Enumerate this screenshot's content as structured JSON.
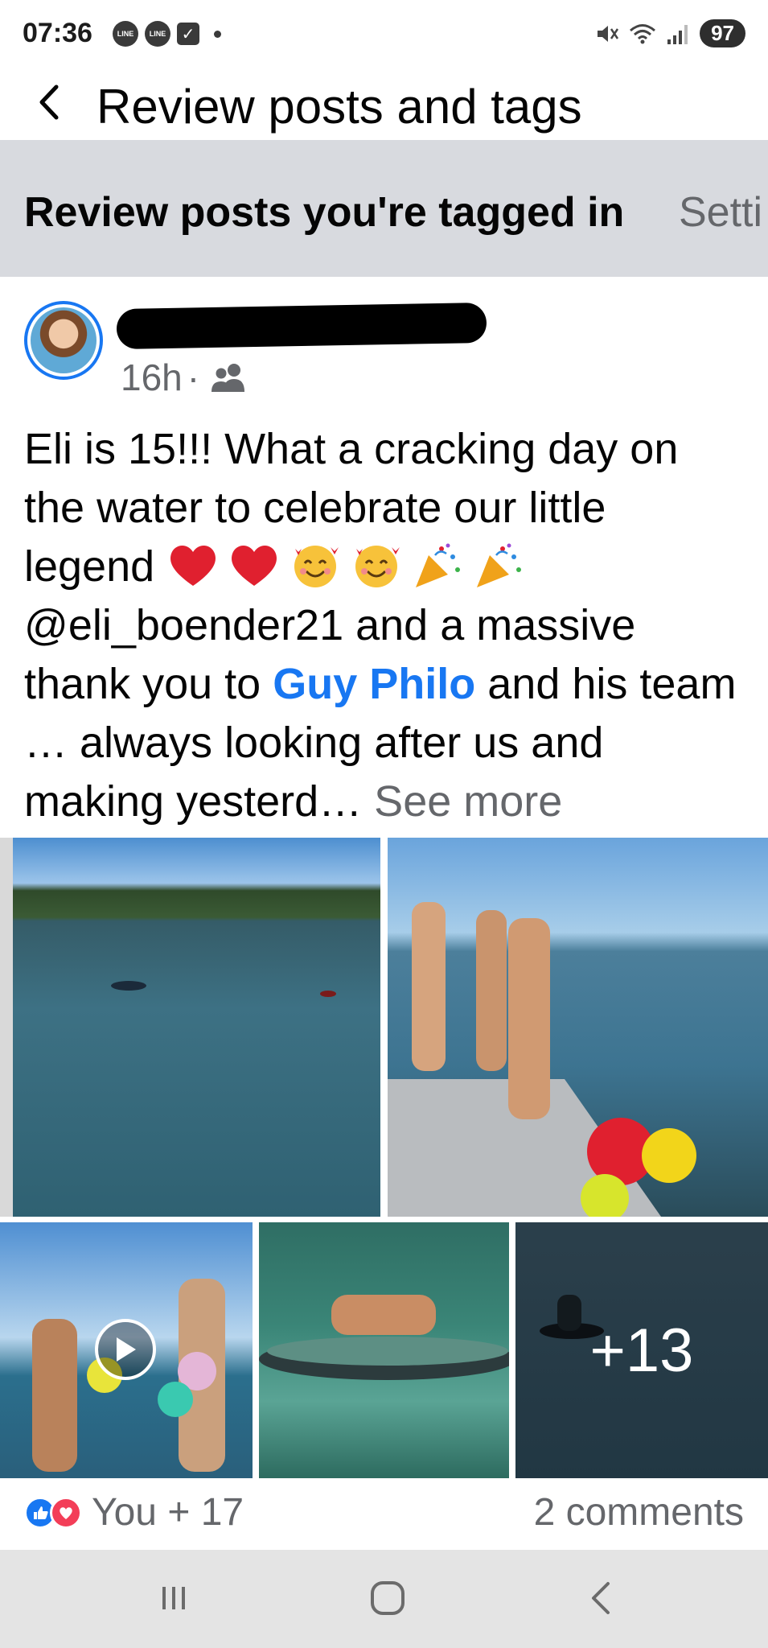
{
  "status_bar": {
    "time": "07:36",
    "left_badges": [
      "LINE",
      "LINE"
    ],
    "battery": "97",
    "icons": [
      "mute-icon",
      "wifi-icon",
      "signal-icon",
      "check-notification-icon"
    ]
  },
  "header": {
    "title": "Review posts and tags",
    "back_icon": "chevron-left-icon"
  },
  "review_bar": {
    "title": "Review posts you're tagged in",
    "settings_partial": "Setti"
  },
  "post": {
    "time_ago": "16h",
    "separator": "·",
    "audience_icon": "friends-icon",
    "text_segments": {
      "intro": "Eli is 15!!! What a cracking day on the water to celebrate our little legend ",
      "handle": " @eli_boender21 and a massive thank you to ",
      "tagged_name": "Guy Philo",
      "rest": " and his team … always looking after us and making yesterd… ",
      "see_more": "See more"
    },
    "emojis": [
      "heart",
      "heart",
      "smiling-face-with-hearts",
      "smiling-face-with-hearts",
      "party-popper",
      "party-popper"
    ],
    "photos": {
      "more_count": "+13"
    },
    "reactions": {
      "summary": "You + 17",
      "types": [
        "like",
        "love"
      ],
      "colors": {
        "like": "#1877f2",
        "love": "#f33e58"
      }
    },
    "comments": "2 comments"
  },
  "colors": {
    "accent": "#1877f2",
    "secondary_text": "#65676b",
    "review_bar_bg": "#d8dadf"
  }
}
